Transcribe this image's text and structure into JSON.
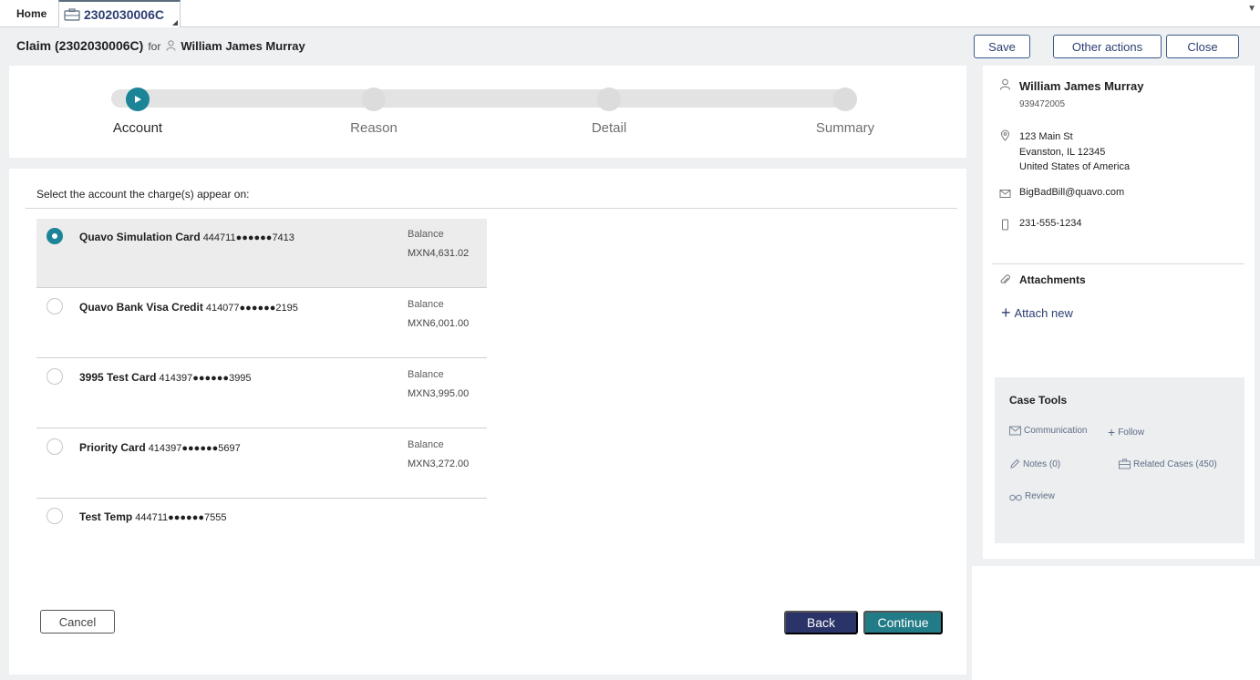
{
  "tabs": {
    "home_label": "Home",
    "active_tab_label": "2302030006C",
    "active_tab_icon": "briefcase-icon"
  },
  "header": {
    "title": "Claim (2302030006C)",
    "for_label": "for",
    "customer_name": "William James Murray",
    "buttons": {
      "save": "Save",
      "other_actions": "Other actions",
      "close": "Close"
    }
  },
  "stepper": {
    "steps": [
      {
        "label": "Account",
        "active": true
      },
      {
        "label": "Reason",
        "active": false
      },
      {
        "label": "Detail",
        "active": false
      },
      {
        "label": "Summary",
        "active": false
      }
    ]
  },
  "account_select": {
    "prompt": "Select the account the charge(s) appear on:",
    "balance_label": "Balance",
    "accounts": [
      {
        "name": "Quavo Simulation Card",
        "number": "444711●●●●●●7413",
        "balance": "MXN4,631.02",
        "selected": true
      },
      {
        "name": "Quavo Bank Visa Credit",
        "number": "414077●●●●●●2195",
        "balance": "MXN6,001.00",
        "selected": false
      },
      {
        "name": "3995 Test Card",
        "number": "414397●●●●●●3995",
        "balance": "MXN3,995.00",
        "selected": false
      },
      {
        "name": "Priority Card",
        "number": "414397●●●●●●5697",
        "balance": "MXN3,272.00",
        "selected": false
      },
      {
        "name": "Test Temp",
        "number": "444711●●●●●●7555",
        "balance": "",
        "selected": false
      }
    ]
  },
  "footer": {
    "cancel": "Cancel",
    "back": "Back",
    "continue": "Continue"
  },
  "customer": {
    "name": "William James Murray",
    "id": "939472005",
    "address_line1": "123 Main St",
    "address_line2": "Evanston, IL 12345",
    "address_line3": "United States of America",
    "email": "BigBadBill@quavo.com",
    "phone": "231-555-1234"
  },
  "attachments": {
    "title": "Attachments",
    "attach_new": "Attach new"
  },
  "case_tools": {
    "title": "Case Tools",
    "communication": "Communication",
    "follow": "Follow",
    "notes": "Notes (0)",
    "related_cases": "Related Cases (450)",
    "review": "Review"
  },
  "colors": {
    "accent_teal": "#1c8497",
    "continue_button": "#227c87",
    "back_button": "#2b3468",
    "link_blue": "#2c3e72",
    "panel_gray": "#eef0f2"
  }
}
